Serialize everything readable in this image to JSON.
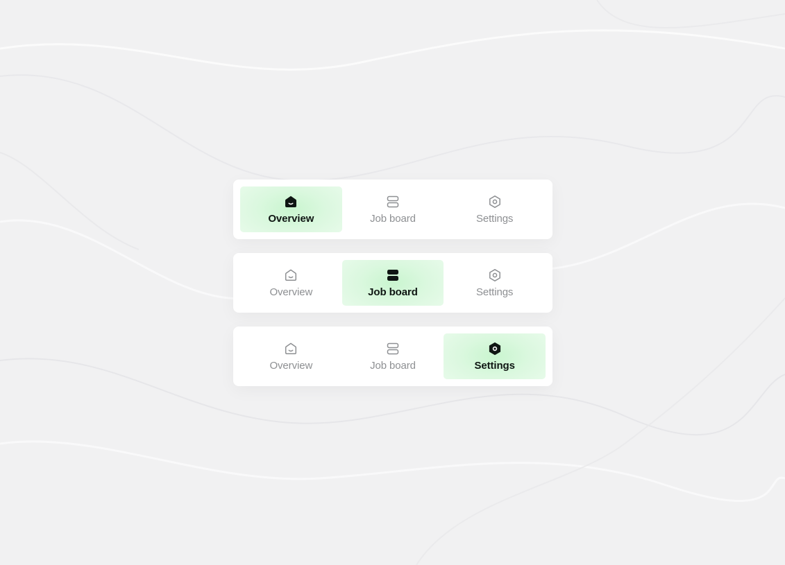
{
  "tab_groups": [
    {
      "active": "overview",
      "tabs": [
        {
          "label": "Overview",
          "icon": "home-icon"
        },
        {
          "label": "Job board",
          "icon": "layers-icon"
        },
        {
          "label": "Settings",
          "icon": "settings-icon"
        }
      ]
    },
    {
      "active": "job-board",
      "tabs": [
        {
          "label": "Overview",
          "icon": "home-icon"
        },
        {
          "label": "Job board",
          "icon": "layers-icon"
        },
        {
          "label": "Settings",
          "icon": "settings-icon"
        }
      ]
    },
    {
      "active": "settings",
      "tabs": [
        {
          "label": "Overview",
          "icon": "home-icon"
        },
        {
          "label": "Job board",
          "icon": "layers-icon"
        },
        {
          "label": "Settings",
          "icon": "settings-icon"
        }
      ]
    }
  ],
  "colors": {
    "active_bg": "#d6f7da",
    "active_text": "#0f1613",
    "inactive_text": "#8d8f92",
    "card_bg": "#ffffff",
    "page_bg": "#f1f1f2"
  }
}
